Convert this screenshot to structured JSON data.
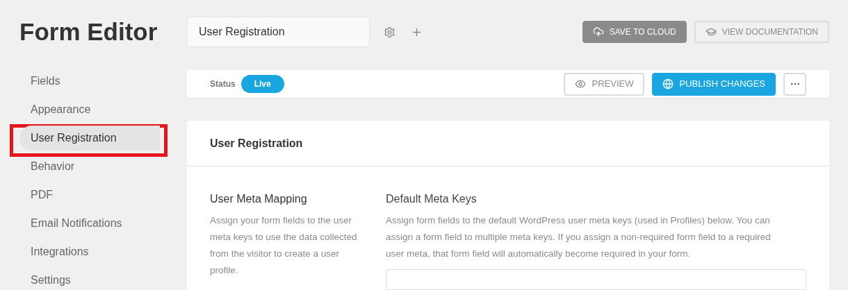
{
  "title": "Form Editor",
  "form_name": {
    "value": "User Registration"
  },
  "top_actions": [
    {
      "label": "SAVE TO CLOUD",
      "kind": "primary"
    },
    {
      "label": "VIEW DOCUMENTATION",
      "kind": "outline"
    }
  ],
  "sidebar": {
    "items": [
      {
        "label": "Fields",
        "selected": false
      },
      {
        "label": "Appearance",
        "selected": false
      },
      {
        "label": "User Registration",
        "selected": true,
        "highlighted": true
      },
      {
        "label": "Behavior",
        "selected": false
      },
      {
        "label": "PDF",
        "selected": false
      },
      {
        "label": "Email Notifications",
        "selected": false
      },
      {
        "label": "Integrations",
        "selected": false
      },
      {
        "label": "Settings",
        "selected": false
      }
    ]
  },
  "status_bar": {
    "label": "Status",
    "status": "Live",
    "buttons": [
      {
        "label": "PREVIEW",
        "kind": "outline"
      },
      {
        "label": "PUBLISH CHANGES",
        "kind": "blue"
      }
    ]
  },
  "panel": {
    "title": "User Registration",
    "left": {
      "heading": "User Meta Mapping",
      "text": "Assign your form fields to the user meta keys to use the data collected from the visitor to create a user profile."
    },
    "right": {
      "heading": "Default Meta Keys",
      "text": "Assign form fields to the default WordPress user meta keys (used in Profiles) below. You can assign a form field to multiple meta keys. If you assign a non-required form field to a required user meta, that form field will automatically become required in your form."
    }
  }
}
